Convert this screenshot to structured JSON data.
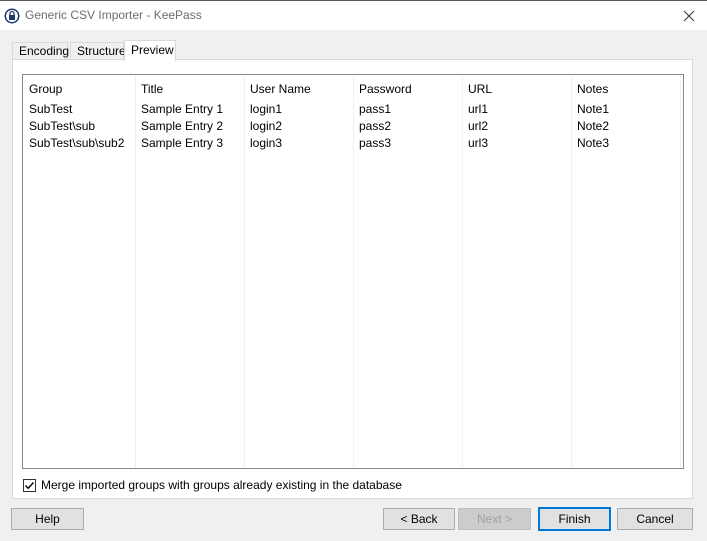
{
  "window": {
    "title": "Generic CSV Importer - KeePass"
  },
  "tabs": [
    {
      "label": "Encoding"
    },
    {
      "label": "Structure"
    },
    {
      "label": "Preview"
    }
  ],
  "active_tab": "Preview",
  "table": {
    "columns": [
      "Group",
      "Title",
      "User Name",
      "Password",
      "URL",
      "Notes"
    ],
    "rows": [
      [
        "SubTest",
        "Sample Entry 1",
        "login1",
        "pass1",
        "url1",
        "Note1"
      ],
      [
        "SubTest\\sub",
        "Sample Entry 2",
        "login2",
        "pass2",
        "url2",
        "Note2"
      ],
      [
        "SubTest\\sub\\sub2",
        "Sample Entry 3",
        "login3",
        "pass3",
        "url3",
        "Note3"
      ]
    ]
  },
  "merge_option": {
    "label": "Merge imported groups with groups already existing in the database",
    "checked": true
  },
  "buttons": {
    "help": "Help",
    "back": "< Back",
    "next": "Next >",
    "finish": "Finish",
    "cancel": "Cancel"
  },
  "icons": {
    "app": "lock-icon",
    "close": "close-icon",
    "check": "checkmark-icon"
  },
  "colors": {
    "accent": "#0078d7",
    "disabled_text": "#a0a0a0"
  }
}
